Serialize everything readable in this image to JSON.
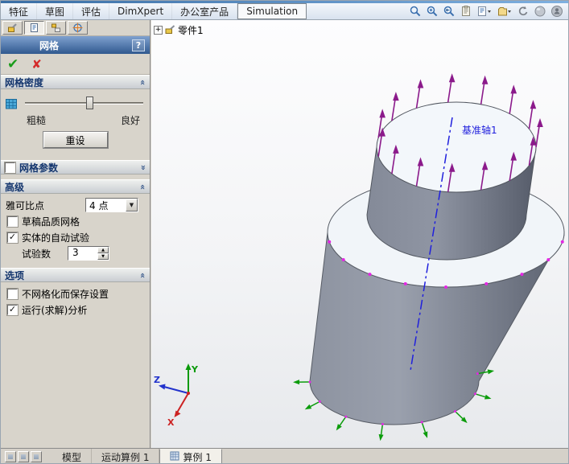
{
  "menubar": {
    "tabs": [
      "特征",
      "草图",
      "评估",
      "DimXpert",
      "办公室产品",
      "Simulation"
    ],
    "active": "Simulation",
    "icons": [
      "zoom-to-fit",
      "zoom-to-area",
      "previous-view",
      "section-view",
      "view-orientation",
      "display-style",
      "rotate-view",
      "appearance",
      "user"
    ]
  },
  "property_manager": {
    "title": "网格",
    "help_label": "?",
    "ok_icon": "✔",
    "cancel_icon": "✘",
    "sections": {
      "mesh_density": {
        "title": "网格密度",
        "coarse_label": "粗糙",
        "fine_label": "良好",
        "reset_button": "重设",
        "slider_value_pct": 55
      },
      "mesh_parameters": {
        "title": "网格参数",
        "checked": false
      },
      "advanced": {
        "title": "高级",
        "jacobian_label": "雅可比点",
        "jacobian_value": "4 点",
        "draft_quality_label": "草稿品质网格",
        "draft_quality_checked": false,
        "auto_trials_label": "实体的自动试验",
        "auto_trials_checked": true,
        "trials_label": "试验数",
        "trials_value": "3"
      },
      "options": {
        "title": "选项",
        "save_without_mesh_label": "不网格化而保存设置",
        "save_without_mesh_checked": false,
        "run_analysis_label": "运行(求解)分析",
        "run_analysis_checked": true
      }
    }
  },
  "feature_tree": {
    "root_label": "零件1"
  },
  "viewport": {
    "axis_label": "基准轴1",
    "axis_color": "#2020dd",
    "load_arrow_color": "#8b1a8b",
    "fixture_arrow_color": "#0c9c0c",
    "dot_color": "#e327e3",
    "triad": {
      "x": "X",
      "y": "Y",
      "z": "Z"
    }
  },
  "statusbar": {
    "tabs": [
      "模型",
      "运动算例 1",
      "算例 1"
    ],
    "active": "算例 1"
  }
}
